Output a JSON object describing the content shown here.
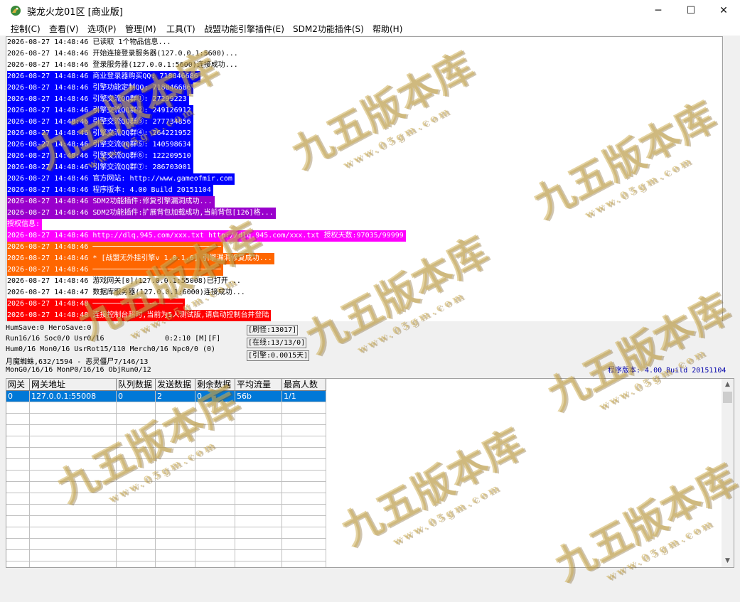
{
  "window": {
    "title": "骁龙火龙01区 [商业版]",
    "minimize": "─",
    "maximize": "☐",
    "close": "✕"
  },
  "menu": [
    "控制(C)",
    "查看(V)",
    "选项(P)",
    "管理(M)",
    "工具(T)",
    "战盟功能引擎插件(E)",
    "SDM2功能插件(S)",
    "帮助(H)"
  ],
  "log": [
    {
      "text": "2026-08-27 14:48:46 已读取 1个物品信息...",
      "bg": "#ffffff",
      "fg": "#000000"
    },
    {
      "text": "2026-08-27 14:48:46 开始连接登录服务器(127.0.0.1:5600)...",
      "bg": "#ffffff",
      "fg": "#000000"
    },
    {
      "text": "2026-08-27 14:48:46 登录服务器(127.0.0.1:5600)连接成功...",
      "bg": "#ffffff",
      "fg": "#000000"
    },
    {
      "text": "2026-08-27 14:48:46 商业登录器购买QQ: 718846686",
      "bg": "#0000ff",
      "fg": "#ffffff"
    },
    {
      "text": "2026-08-27 14:48:46 引擎功能定制QQ: 718846686",
      "bg": "#0000ff",
      "fg": "#ffffff"
    },
    {
      "text": "2026-08-27 14:48:46 引擎交流QQ群①: 27299223",
      "bg": "#0000ff",
      "fg": "#ffffff"
    },
    {
      "text": "2026-08-27 14:48:46 引擎交流QQ群②: 249126912",
      "bg": "#0000ff",
      "fg": "#ffffff"
    },
    {
      "text": "2026-08-27 14:48:46 引擎交流QQ群③: 277734856",
      "bg": "#0000ff",
      "fg": "#ffffff"
    },
    {
      "text": "2026-08-27 14:48:46 引擎交流QQ群④: 264221952",
      "bg": "#0000ff",
      "fg": "#ffffff"
    },
    {
      "text": "2026-08-27 14:48:46 引擎交流QQ群⑤: 140598634",
      "bg": "#0000ff",
      "fg": "#ffffff"
    },
    {
      "text": "2026-08-27 14:48:46 引擎交流QQ群⑥: 122209510",
      "bg": "#0000ff",
      "fg": "#ffffff"
    },
    {
      "text": "2026-08-27 14:48:46 引擎交流QQ群⑦: 286703001",
      "bg": "#0000ff",
      "fg": "#ffffff"
    },
    {
      "text": "2026-08-27 14:48:46 官方网站: http://www.gameofmir.com",
      "bg": "#0000ff",
      "fg": "#ffffff"
    },
    {
      "text": "2026-08-27 14:48:46 程序版本: 4.00 Build 20151104",
      "bg": "#0000ff",
      "fg": "#ffffff"
    },
    {
      "text": "2026-08-27 14:48:46 SDM2功能插件:修复引擎漏洞成功...",
      "bg": "#9900cc",
      "fg": "#ffffff"
    },
    {
      "text": "2026-08-27 14:48:46 SDM2功能插件:扩展背包加载成功,当前背包[126]格...",
      "bg": "#9900cc",
      "fg": "#ffffff"
    },
    {
      "text": "授权信息:",
      "bg": "#ff00ff",
      "fg": "#ffffff"
    },
    {
      "text": "2026-08-27 14:48:46 http://dlq.945.com/xxx.txt http://dlq.945.com/xxx.txt 授权天数:97035/99999",
      "bg": "#ff00ff",
      "fg": "#ffffff"
    },
    {
      "text": "2026-08-27 14:48:46 ──────────────────────────────",
      "bg": "#ff6600",
      "fg": "#ffffff"
    },
    {
      "text": "2026-08-27 14:48:46 * [战盟无外挂引擎v 1.0.1.6] 引擎漏洞修复成功...",
      "bg": "#ff6600",
      "fg": "#ffffff"
    },
    {
      "text": "2026-08-27 14:48:46 ──────────────────────────────",
      "bg": "#ff6600",
      "fg": "#ffffff"
    },
    {
      "text": "2026-08-27 14:48:46 游戏网关[0](127.0.0.1:55008)已打开...",
      "bg": "#ffffff",
      "fg": "#000000"
    },
    {
      "text": "2026-08-27 14:48:47 数据库服务器(127.0.0.1:6000)连接成功...",
      "bg": "#ffffff",
      "fg": "#000000"
    },
    {
      "text": "2026-08-27 14:48:48 ─────────────────────",
      "bg": "#ff0000",
      "fg": "#ffffff"
    },
    {
      "text": "2026-08-27 14:48:48 连接控制台超时,当前为5人测试版,请启动控制台并登陆",
      "bg": "#ff0000",
      "fg": "#ffffff"
    }
  ],
  "status": {
    "line1": "HumSave:0 HeroSave:0",
    "line2a": "Run16/16 Soc0/0 Usr0/16",
    "line2b": "0:2:10 [M][F]",
    "line3": "Hum0/16 Mon0/16 UsrRot15/110 Merch0/16 Npc0/0 (0)",
    "line4": "月魔蜘蛛,632/1594 - 恶灵僵尸7/146/13",
    "line5": "MonG0/16/16 MonP0/16/16 ObjRun0/12",
    "box1": "[刷怪:13017]",
    "box2": "[在线:13/13/0]",
    "box3": "[引擎:0.0015天]",
    "version": "程序版本: 4.00 Build 20151104"
  },
  "grid": {
    "headers": [
      "网关",
      "网关地址",
      "队列数据",
      "发送数据",
      "剩余数据",
      "平均流量",
      "最高人数"
    ],
    "rows": [
      [
        "0",
        "127.0.0.1:55008",
        "0",
        "2",
        "0",
        "56b",
        "1/1"
      ]
    ]
  },
  "watermark": {
    "main": "九五版本库",
    "sub": "www.05gm.com"
  },
  "colors": {
    "selection": "#0078d7",
    "version_text": "#0000aa"
  }
}
